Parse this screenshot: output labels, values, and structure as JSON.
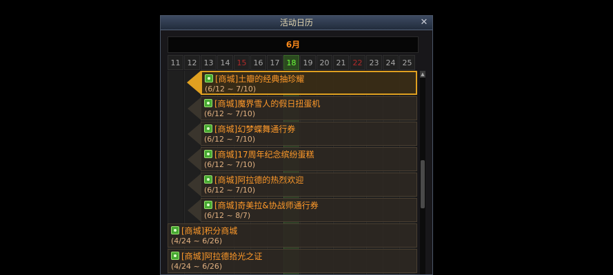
{
  "window": {
    "title": "活动日历",
    "close_symbol": "✕"
  },
  "calendar": {
    "month": "6月",
    "days": [
      "11",
      "12",
      "13",
      "14",
      "15",
      "16",
      "17",
      "18",
      "19",
      "20",
      "21",
      "22",
      "23",
      "24",
      "25"
    ],
    "weekend_days": [
      "15",
      "22"
    ],
    "today": "18"
  },
  "events": [
    {
      "name": "[商城]土瓣的经典抽珍耀",
      "dates": "(6/12 ~ 7/10)",
      "selected": true
    },
    {
      "name": "[商城]魔界雪人的假日扭蛋机",
      "dates": "(6/12 ~ 7/10)"
    },
    {
      "name": "[商城]幻梦蝶舞通行券",
      "dates": "(6/12 ~ 7/10)"
    },
    {
      "name": "[商城]17周年纪念缤纷蛋糕",
      "dates": "(6/12 ~ 7/10)"
    },
    {
      "name": "[商城]阿拉德的热烈欢迎",
      "dates": "(6/12 ~ 7/10)"
    },
    {
      "name": "[商城]奇美拉&协战师通行券",
      "dates": "(6/12 ~ 8/7)"
    },
    {
      "name": "[商城]积分商城",
      "dates": "(4/24 ~ 6/26)"
    },
    {
      "name": "[商城]阿拉德拾光之证",
      "dates": "(4/24 ~ 6/26)"
    }
  ],
  "colors": {
    "accent": "#e0a020",
    "event_text": "#ff9a2a",
    "today": "#6cff3b",
    "weekend": "#b22a2a"
  }
}
